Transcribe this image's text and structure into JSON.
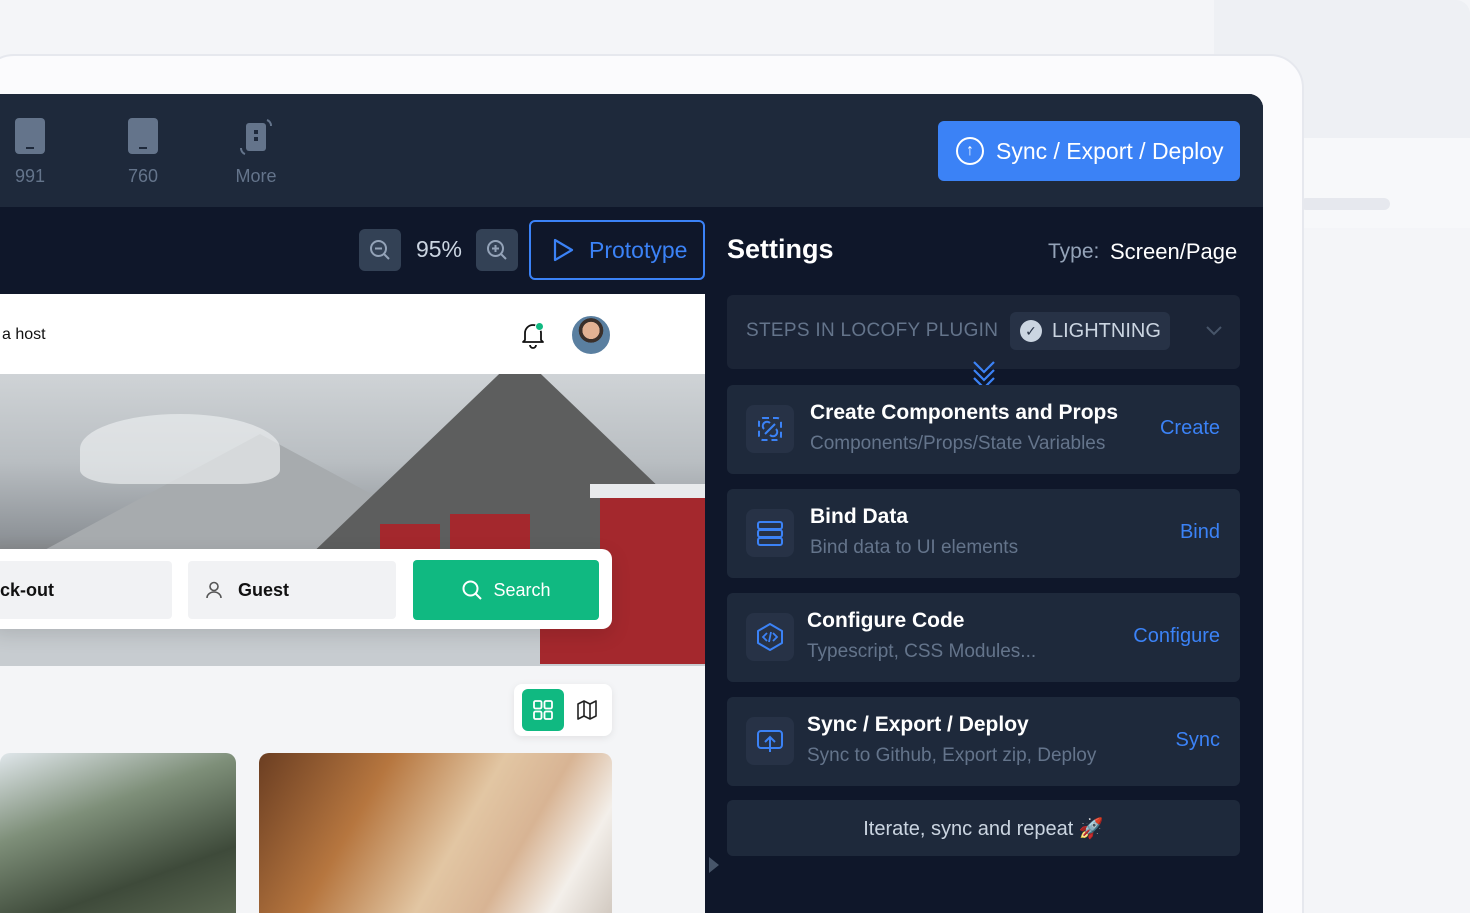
{
  "toolbar": {
    "devices": [
      {
        "label": "991"
      },
      {
        "label": "760"
      },
      {
        "label": "More"
      }
    ],
    "sync_button": "Sync / Export / Deploy"
  },
  "canvas_controls": {
    "zoom": "95%",
    "prototype_label": "Prototype"
  },
  "preview": {
    "host_text": "a host",
    "checkout_text": "ck-out",
    "guest_text": "Guest",
    "search_label": "Search"
  },
  "settings": {
    "title": "Settings",
    "type_label": "Type:",
    "type_value": "Screen/Page",
    "steps_label": "STEPS IN LOCOFY PLUGIN",
    "mode_label": "LIGHTNING",
    "steps": [
      {
        "title": "Create Components and Props",
        "subtitle": "Components/Props/State Variables",
        "action": "Create"
      },
      {
        "title": "Bind Data",
        "subtitle": "Bind data to UI elements",
        "action": "Bind"
      },
      {
        "title": "Configure Code",
        "subtitle": "Typescript, CSS Modules...",
        "action": "Configure"
      },
      {
        "title": "Sync / Export / Deploy",
        "subtitle": "Sync to Github, Export zip, Deploy",
        "action": "Sync"
      }
    ],
    "iterate_text": "Iterate, sync and repeat 🚀"
  },
  "colors": {
    "accent": "#3b82f6",
    "panel_bg": "#0f172a",
    "card_bg": "#1e293b",
    "success": "#10b981"
  }
}
